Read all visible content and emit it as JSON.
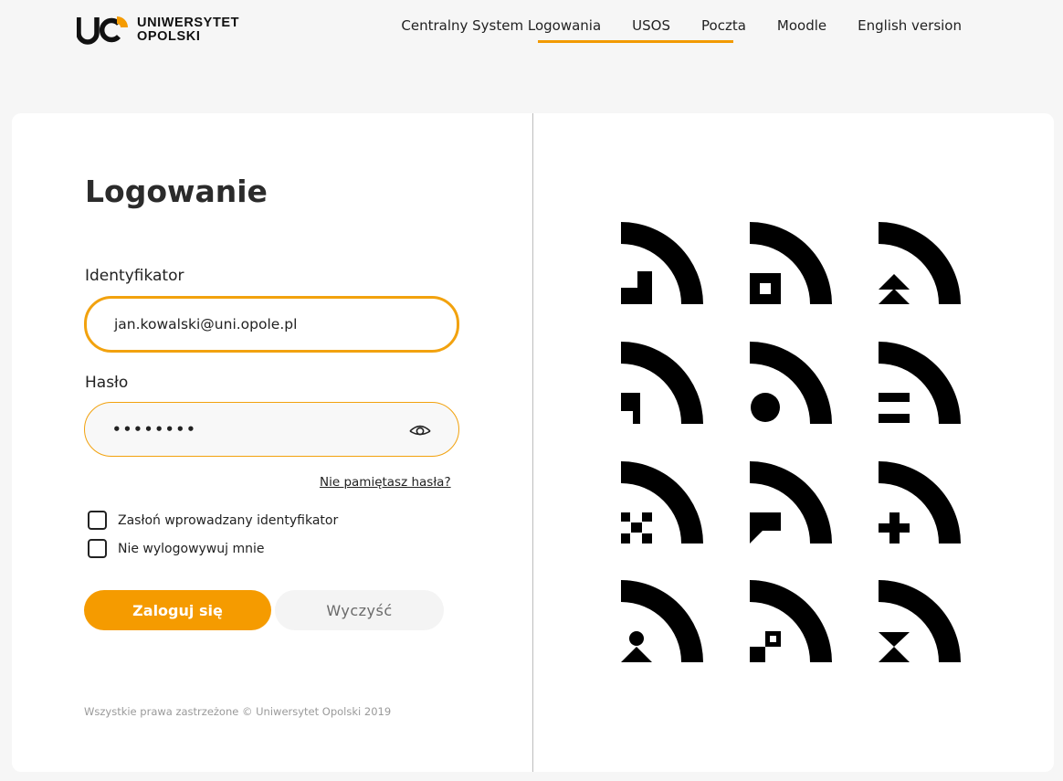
{
  "brand": {
    "logo_line1": "UNIWERSYTET",
    "logo_line2": "OPOLSKI",
    "accent_color": "#f59b00",
    "logo_mark_icon": "uo-logo-mark"
  },
  "nav": {
    "items": [
      {
        "label": "Centralny System Logowania",
        "active": true
      },
      {
        "label": "USOS",
        "active": false
      },
      {
        "label": "Poczta",
        "active": false
      },
      {
        "label": "Moodle",
        "active": false
      },
      {
        "label": "English version",
        "active": false
      }
    ]
  },
  "login": {
    "title": "Logowanie",
    "id_label": "Identyfikator",
    "id_value": "jan.kowalski@uni.opole.pl",
    "password_label": "Hasło",
    "password_value": "••••••••",
    "show_password_icon": "eye-icon",
    "forgot_link": "Nie pamiętasz hasła?",
    "mask_id_label": "Zasłoń wprowadzany identyfikator",
    "mask_id_checked": false,
    "remember_label": "Nie wylogowywuj mnie",
    "remember_checked": false,
    "submit_label": "Zaloguj się",
    "clear_label": "Wyczyść",
    "copyright": "Wszystkie prawa zastrzeżone © Uniwersytet Opolski 2019"
  },
  "pattern": {
    "tiles": [
      "step",
      "square-hole",
      "double-chevron",
      "notch",
      "circle",
      "equals",
      "checker",
      "speech-bubble",
      "plus",
      "person",
      "diagonal-squares",
      "hourglass"
    ]
  }
}
